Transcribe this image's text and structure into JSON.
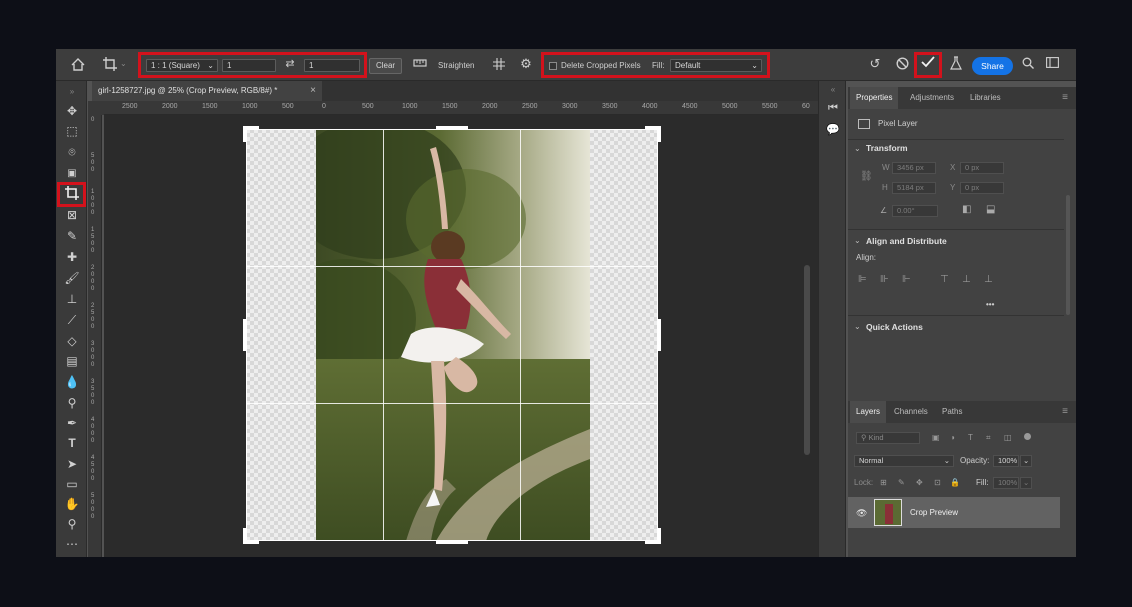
{
  "options_bar": {
    "home_icon": "home-icon",
    "crop_tool_icon": "crop-icon",
    "ratio_preset": "1 : 1 (Square)",
    "ratio_width": "1",
    "ratio_height": "1",
    "swap_icon": "swap-arrows-icon",
    "clear_label": "Clear",
    "straighten_label": "Straighten",
    "delete_cropped_label": "Delete Cropped Pixels",
    "fill_label": "Fill:",
    "fill_value": "Default",
    "share_label": "Share"
  },
  "document_tab": {
    "title": "girl-1258727.jpg @ 25% (Crop Preview, RGB/8#) *",
    "close": "×"
  },
  "ruler": {
    "h_ticks": [
      "2500",
      "2000",
      "1500",
      "1000",
      "500",
      "0",
      "500",
      "1000",
      "1500",
      "2000",
      "2500",
      "3000",
      "3500",
      "4000",
      "4500",
      "5000",
      "5500",
      "60"
    ],
    "v_ticks": [
      "0",
      "500",
      "1000",
      "1500",
      "2000",
      "2500",
      "3000",
      "3500",
      "4000",
      "4500",
      "5000"
    ]
  },
  "panels": {
    "top_tabs": [
      "Properties",
      "Adjustments",
      "Libraries"
    ],
    "layer_type": "Pixel Layer",
    "transform_title": "Transform",
    "w_label": "W",
    "w_value": "3456 px",
    "h_label": "H",
    "h_value": "5184 px",
    "x_label": "X",
    "x_value": "0 px",
    "y_label": "Y",
    "y_value": "0 px",
    "angle_value": "0.00°",
    "align_title": "Align and Distribute",
    "align_label": "Align:",
    "more": "•••",
    "quick_actions_title": "Quick Actions",
    "layer_tabs": [
      "Layers",
      "Channels",
      "Paths"
    ],
    "kind_placeholder": "Kind",
    "blend_mode": "Normal",
    "opacity_label": "Opacity:",
    "opacity_value": "100%",
    "lock_label": "Lock:",
    "fill_label": "Fill:",
    "fill_value": "100%",
    "layer_name": "Crop Preview"
  },
  "colors": {
    "highlight": "#d3121c",
    "share_button": "#1473e6",
    "app_bg": "#535353"
  }
}
